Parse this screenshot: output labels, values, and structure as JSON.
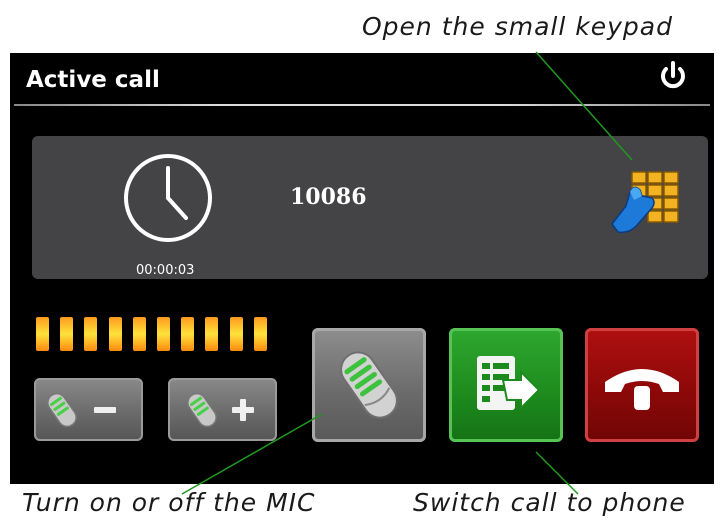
{
  "annotations": {
    "keypad_caption": "Open the small keypad",
    "mic_caption": "Turn on or off the MIC",
    "switch_caption": "Switch call to phone"
  },
  "window": {
    "title": "Active call",
    "power_icon": "power-icon"
  },
  "call": {
    "number": "10086",
    "duration": "00:00:03",
    "clock_icon": "clock-icon",
    "keypad_icon": "keypad-hand-icon"
  },
  "controls": {
    "mic_level_segments": 10,
    "volume_down_icon": "mic-minus-icon",
    "volume_up_icon": "mic-plus-icon",
    "mic_toggle_icon": "microphone-icon",
    "switch_icon": "switch-to-phone-icon",
    "hangup_icon": "hang-up-icon"
  },
  "colors": {
    "screen_bg": "#000000",
    "panel_bg": "#444446",
    "level_orange": "#ff9a1f",
    "level_yellow": "#ffe23a",
    "switch_green": "#1d8a1d",
    "hangup_red": "#8a0808",
    "annotation_line": "#1e9a1e"
  }
}
